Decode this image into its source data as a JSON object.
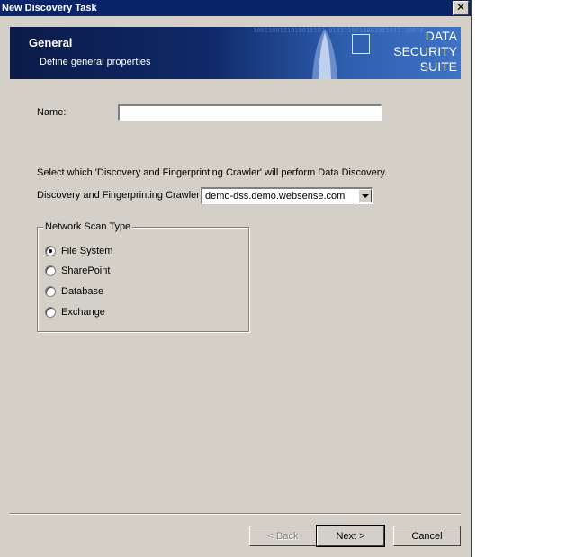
{
  "window": {
    "title": "New Discovery Task",
    "close_glyph": "✕"
  },
  "banner": {
    "title": "General",
    "subtitle": "Define general properties",
    "brand_line1": "DATA",
    "brand_line2": "SECURITY",
    "brand_line3": "SUITE",
    "binary_pattern": "1001100111010011101 0101110011001011011 1001011100101110011 0001001101101100010 0111001011011101101 1100101001101110010 0101101101001101011"
  },
  "form": {
    "name_label": "Name:",
    "name_value": "",
    "instruction": "Select which 'Discovery and Fingerprinting Crawler' will perform Data Discovery.",
    "crawler_label": "Discovery and Fingerprinting Crawler",
    "crawler_value": "demo-dss.demo.websense.com",
    "scan_type_legend": "Network Scan Type",
    "scan_types": [
      {
        "label": "File System",
        "checked": true
      },
      {
        "label": "SharePoint",
        "checked": false
      },
      {
        "label": "Database",
        "checked": false
      },
      {
        "label": "Exchange",
        "checked": false
      }
    ]
  },
  "buttons": {
    "back_label": "< Back",
    "next_label": "Next >",
    "cancel_label": "Cancel"
  },
  "colors": {
    "dialog_bg": "#d4d0c8",
    "titlebar": "#0a246a",
    "banner_dark": "#0b1a48",
    "banner_light": "#3e73c6"
  }
}
